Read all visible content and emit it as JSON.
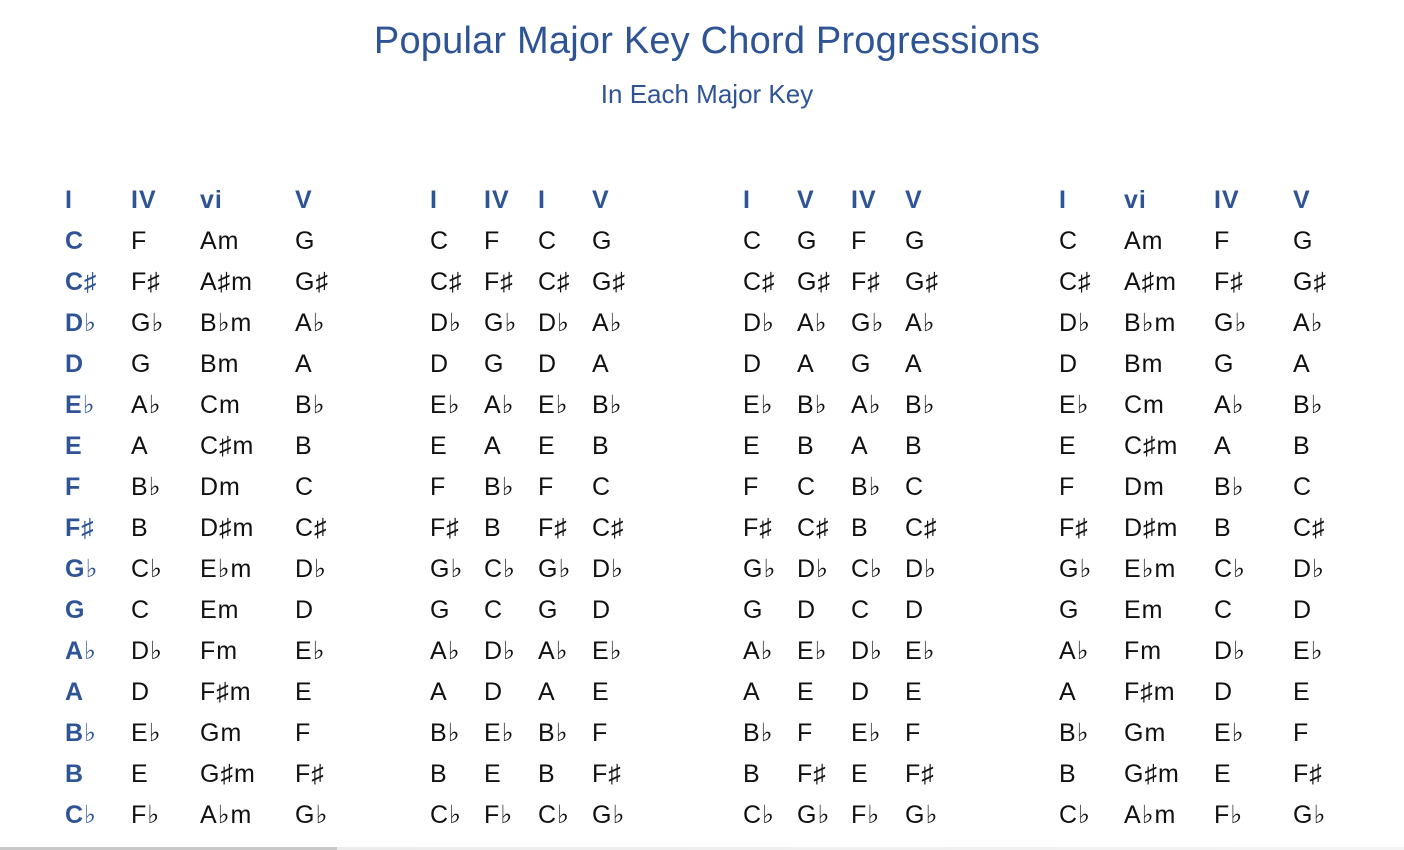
{
  "header": {
    "title": "Popular Major Key Chord Progressions",
    "subtitle": "In Each Major Key"
  },
  "colors": {
    "accent": "#2f5496",
    "text": "#111111",
    "background": "#ffffff"
  },
  "tables": [
    {
      "name": "I-IV-vi-V",
      "headers": [
        "I",
        "IV",
        "vi",
        "V"
      ],
      "rows": [
        [
          "C",
          "F",
          "Am",
          "G"
        ],
        [
          "C♯",
          "F♯",
          "A♯m",
          "G♯"
        ],
        [
          "D♭",
          "G♭",
          "B♭m",
          "A♭"
        ],
        [
          "D",
          "G",
          "Bm",
          "A"
        ],
        [
          "E♭",
          "A♭",
          "Cm",
          "B♭"
        ],
        [
          "E",
          "A",
          "C♯m",
          "B"
        ],
        [
          "F",
          "B♭",
          "Dm",
          "C"
        ],
        [
          "F♯",
          "B",
          "D♯m",
          "C♯"
        ],
        [
          "G♭",
          "C♭",
          "E♭m",
          "D♭"
        ],
        [
          "G",
          "C",
          "Em",
          "D"
        ],
        [
          "A♭",
          "D♭",
          "Fm",
          "E♭"
        ],
        [
          "A",
          "D",
          "F♯m",
          "E"
        ],
        [
          "B♭",
          "E♭",
          "Gm",
          "F"
        ],
        [
          "B",
          "E",
          "G♯m",
          "F♯"
        ],
        [
          "C♭",
          "F♭",
          "A♭m",
          "G♭"
        ]
      ]
    },
    {
      "name": "I-IV-I-V",
      "headers": [
        "I",
        "IV",
        "I",
        "V"
      ],
      "rows": [
        [
          "C",
          "F",
          "C",
          "G"
        ],
        [
          "C♯",
          "F♯",
          "C♯",
          "G♯"
        ],
        [
          "D♭",
          "G♭",
          "D♭",
          "A♭"
        ],
        [
          "D",
          "G",
          "D",
          "A"
        ],
        [
          "E♭",
          "A♭",
          "E♭",
          "B♭"
        ],
        [
          "E",
          "A",
          "E",
          "B"
        ],
        [
          "F",
          "B♭",
          "F",
          "C"
        ],
        [
          "F♯",
          "B",
          "F♯",
          "C♯"
        ],
        [
          "G♭",
          "C♭",
          "G♭",
          "D♭"
        ],
        [
          "G",
          "C",
          "G",
          "D"
        ],
        [
          "A♭",
          "D♭",
          "A♭",
          "E♭"
        ],
        [
          "A",
          "D",
          "A",
          "E"
        ],
        [
          "B♭",
          "E♭",
          "B♭",
          "F"
        ],
        [
          "B",
          "E",
          "B",
          "F♯"
        ],
        [
          "C♭",
          "F♭",
          "C♭",
          "G♭"
        ]
      ]
    },
    {
      "name": "I-V-IV-V",
      "headers": [
        "I",
        "V",
        "IV",
        "V"
      ],
      "rows": [
        [
          "C",
          "G",
          "F",
          "G"
        ],
        [
          "C♯",
          "G♯",
          "F♯",
          "G♯"
        ],
        [
          "D♭",
          "A♭",
          "G♭",
          "A♭"
        ],
        [
          "D",
          "A",
          "G",
          "A"
        ],
        [
          "E♭",
          "B♭",
          "A♭",
          "B♭"
        ],
        [
          "E",
          "B",
          "A",
          "B"
        ],
        [
          "F",
          "C",
          "B♭",
          "C"
        ],
        [
          "F♯",
          "C♯",
          "B",
          "C♯"
        ],
        [
          "G♭",
          "D♭",
          "C♭",
          "D♭"
        ],
        [
          "G",
          "D",
          "C",
          "D"
        ],
        [
          "A♭",
          "E♭",
          "D♭",
          "E♭"
        ],
        [
          "A",
          "E",
          "D",
          "E"
        ],
        [
          "B♭",
          "F",
          "E♭",
          "F"
        ],
        [
          "B",
          "F♯",
          "E",
          "F♯"
        ],
        [
          "C♭",
          "G♭",
          "F♭",
          "G♭"
        ]
      ]
    },
    {
      "name": "I-vi-IV-V",
      "headers": [
        "I",
        "vi",
        "IV",
        "V"
      ],
      "rows": [
        [
          "C",
          "Am",
          "F",
          "G"
        ],
        [
          "C♯",
          "A♯m",
          "F♯",
          "G♯"
        ],
        [
          "D♭",
          "B♭m",
          "G♭",
          "A♭"
        ],
        [
          "D",
          "Bm",
          "G",
          "A"
        ],
        [
          "E♭",
          "Cm",
          "A♭",
          "B♭"
        ],
        [
          "E",
          "C♯m",
          "A",
          "B"
        ],
        [
          "F",
          "Dm",
          "B♭",
          "C"
        ],
        [
          "F♯",
          "D♯m",
          "B",
          "C♯"
        ],
        [
          "G♭",
          "E♭m",
          "C♭",
          "D♭"
        ],
        [
          "G",
          "Em",
          "C",
          "D"
        ],
        [
          "A♭",
          "Fm",
          "D♭",
          "E♭"
        ],
        [
          "A",
          "F♯m",
          "D",
          "E"
        ],
        [
          "B♭",
          "Gm",
          "E♭",
          "F"
        ],
        [
          "B",
          "G♯m",
          "E",
          "F♯"
        ],
        [
          "C♭",
          "A♭m",
          "F♭",
          "G♭"
        ]
      ]
    }
  ]
}
